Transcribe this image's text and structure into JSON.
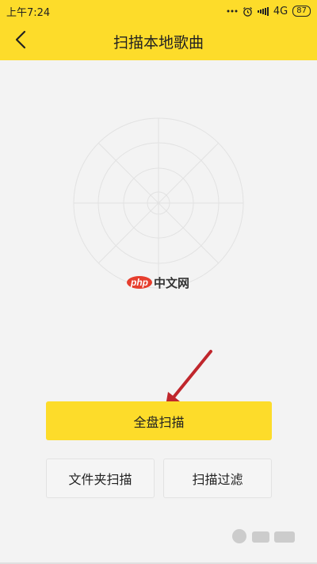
{
  "status_bar": {
    "time": "上午7:24",
    "network": "4G",
    "battery": "87"
  },
  "header": {
    "title": "扫描本地歌曲"
  },
  "watermark": {
    "badge": "php",
    "text": "中文网"
  },
  "actions": {
    "full_scan_label": "全盘扫描",
    "folder_scan_label": "文件夹扫描",
    "scan_filter_label": "扫描过滤"
  },
  "icons": {
    "back": "chevron-left-icon",
    "alarm": "alarm-icon",
    "signal": "signal-icon"
  },
  "colors": {
    "accent": "#fddc2a",
    "background": "#f3f3f3",
    "annotation_arrow": "#c0262c"
  }
}
